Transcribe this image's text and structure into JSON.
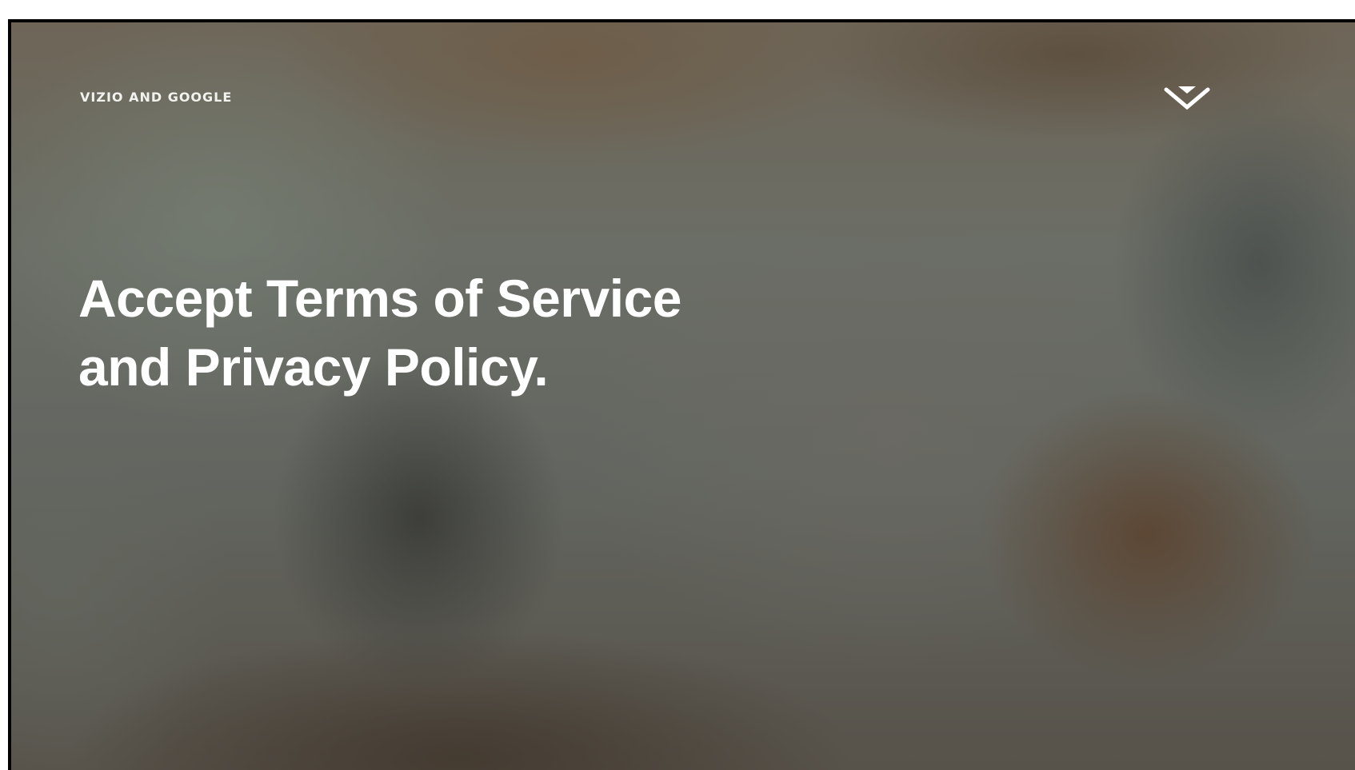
{
  "header": {
    "brand_label": "VIZIO AND GOOGLE",
    "logo_icon": "vizio-v-chevron-icon"
  },
  "main": {
    "headline_lines": [
      "Accept Terms of Service",
      "and Privacy Policy."
    ]
  },
  "colors": {
    "text": "#ffffff",
    "frame_border": "#000000"
  }
}
